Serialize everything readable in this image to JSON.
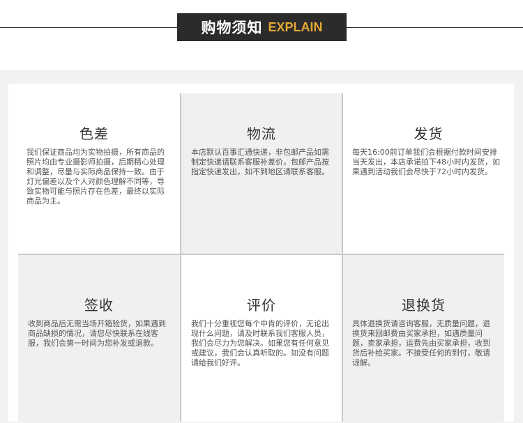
{
  "header": {
    "title_cn": "购物须知",
    "title_en": "EXPLAIN"
  },
  "cells": [
    {
      "title": "色差",
      "text": "我们保证商品均为实物拍摄，所有商品的照片均由专业摄影师拍摄，后期精心处理和调整，尽量与实际商品保持一致。由于灯光偏差以及个人对颜色理解不同等，导致实物可能与照片存在色差，最终以实际商品为主。"
    },
    {
      "title": "物流",
      "text": "本店默认百事汇通快递，非包邮产品如需制定快递请联系客服补差价，包邮产品按指定快递发出，如不到地区请联系客服。"
    },
    {
      "title": "发货",
      "text": "每天16:00前订单我们会根据付款时间安排当天发出，本店承诺拍下48小时内发货，如果遇到活动我们会尽快于72小时内发货。"
    },
    {
      "title": "签收",
      "text": "收到商品后无需当场开箱验货，如果遇到商品缺损的情况，请您尽快联系在线客服，我们会第一时间为您补发或退款。"
    },
    {
      "title": "评价",
      "text": "我们十分重视您每个中肯的评价，无论出现什么问题，请及时联系我们客服人员，我们会尽力为您解决。如果您有任何意见或建议，我们会认真听取的。如没有问题请给我们好评。"
    },
    {
      "title": "退换货",
      "text": "具体退换货请咨询客服，无质量问题，退换货来回邮费由买家承担，如遇质量问题，卖家承担，运费先由买家承担，收到货后补给买家。不接受任何的到付，敬请谅解。"
    }
  ]
}
